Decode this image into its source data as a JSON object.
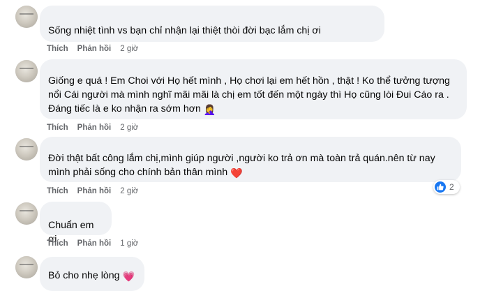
{
  "comments": [
    {
      "author": "",
      "text": "Sống nhiệt tình vs bạn chỉ nhận lại thiệt thòi đời bạc lắm chị ơi",
      "like": "Thích",
      "reply": "Phản hồi",
      "time": "2 giờ"
    },
    {
      "author": "",
      "text": "Giống e quá ! Em Choi với Họ hết mình , Họ chơi lại em hết hồn , thật ! Ko thể tưởng tượng nổi Cái người mà mình nghĩ mãi mãi là chị em tốt đến một ngày thì Họ cũng lòi Đui Cáo ra . Đáng tiếc là e ko nhận ra sớm hơn",
      "emoji": "🤦‍♀️",
      "like": "Thích",
      "reply": "Phản hồi",
      "time": "2 giờ"
    },
    {
      "author": "",
      "text": "Đời thật bất công lắm chị,mình giúp người ,người ko trả ơn mà toàn trả quán.nên từ nay mình phải sống cho chính bản thân mình",
      "emoji": "❤️",
      "like": "Thích",
      "reply": "Phản hồi",
      "time": "2 giờ",
      "reaction_count": "2"
    },
    {
      "author": "",
      "text": "Chuẩn em ơi",
      "like": "Thích",
      "reply": "Phản hồi",
      "time": "1 giờ"
    },
    {
      "author": "",
      "text": "Bỏ cho nhẹ lòng",
      "emoji": "💗"
    }
  ],
  "icons": {
    "like_reaction": "like-icon",
    "like_color": "#1877f2"
  }
}
